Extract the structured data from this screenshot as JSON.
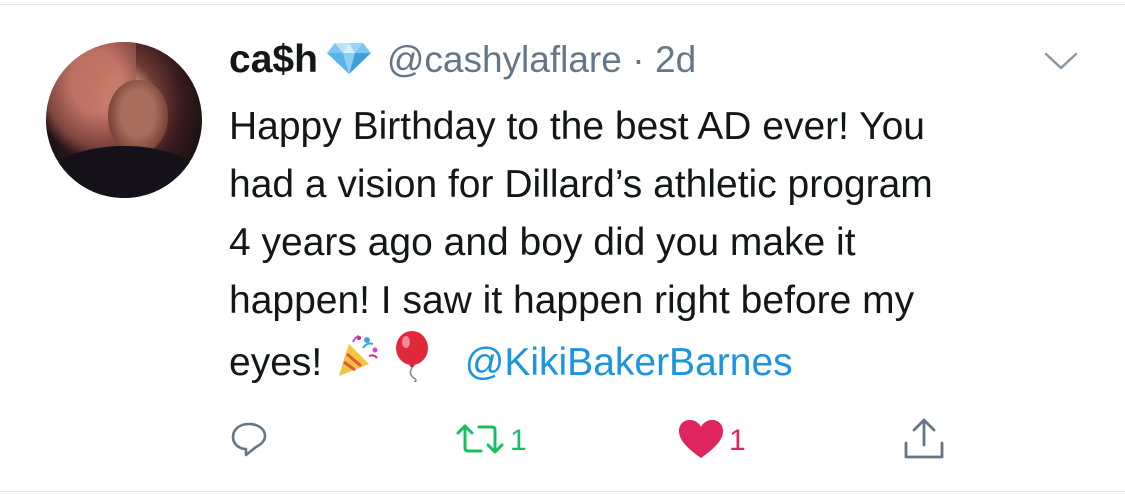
{
  "tweet": {
    "author": {
      "display_name": "ca$h",
      "name_emoji": "gem-icon",
      "handle": "@cashylaflare",
      "separator": "·",
      "timestamp": "2d"
    },
    "text_lines": [
      "Happy Birthday to the best AD ever! You",
      "had a vision for Dillard’s athletic program",
      "4 years ago and boy did you make it",
      "happen!  I saw it happen right before my",
      "eyes!"
    ],
    "trailing_emojis": [
      "party-popper-icon",
      "balloon-icon"
    ],
    "mention": "@KikiBakerBarnes",
    "actions": {
      "reply_count": "",
      "retweet_count": "1",
      "like_count": "1"
    },
    "colors": {
      "text": "#14171a",
      "secondary": "#657786",
      "link": "#1b95e0",
      "retweet": "#17bf63",
      "like": "#e0245e"
    }
  }
}
